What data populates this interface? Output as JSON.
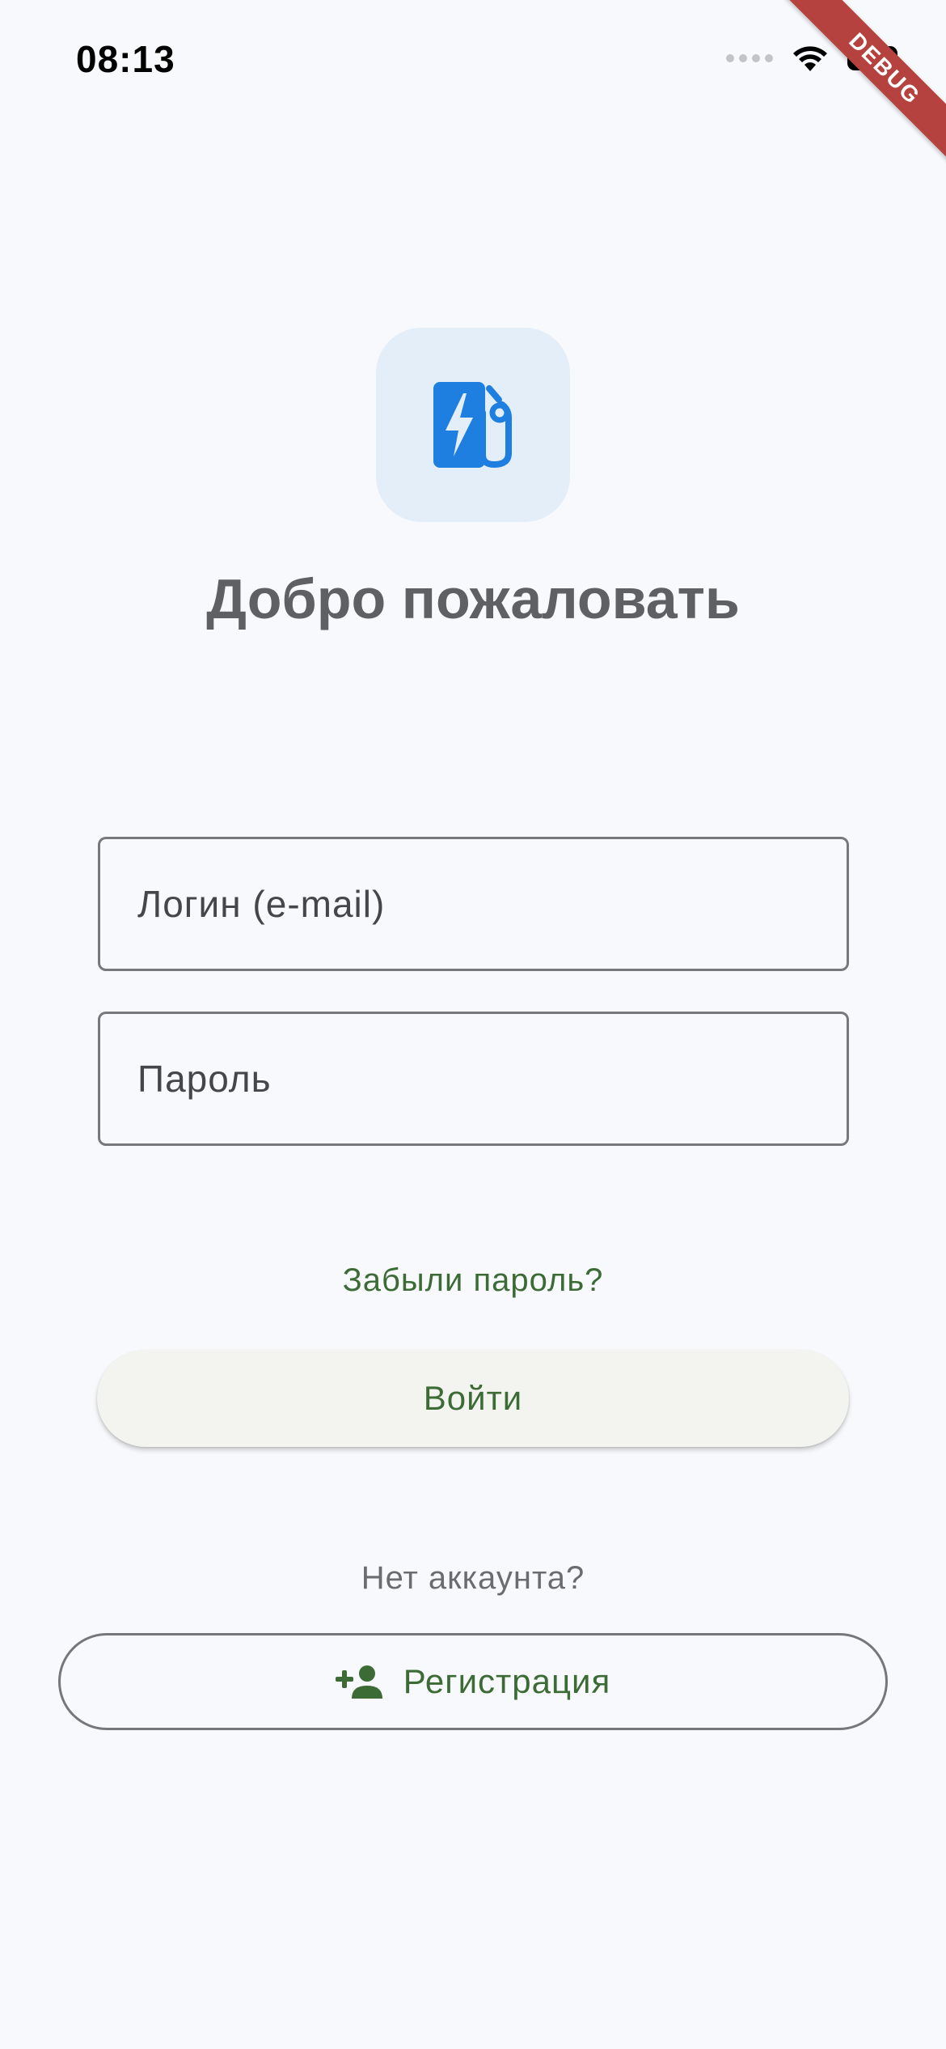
{
  "status_bar": {
    "time": "08:13",
    "icons": [
      "signal-dots-icon",
      "wifi-icon",
      "battery-icon"
    ]
  },
  "debug_banner": {
    "label": "DEBUG",
    "color": "#b5423f"
  },
  "logo": {
    "icon": "ev-charging-station-icon",
    "icon_color": "#1e7fe0",
    "tile_color": "#e4eef9"
  },
  "title": "Добро пожаловать",
  "login_field": {
    "placeholder": "Логин (e-mail)",
    "value": ""
  },
  "password_field": {
    "placeholder": "Пароль",
    "value": ""
  },
  "forgot_password": "Забыли пароль?",
  "login_button": "Войти",
  "no_account": "Нет аккаунта?",
  "register_button": {
    "label": "Регистрация",
    "icon": "person-add-icon"
  },
  "colors": {
    "accent": "#3c6b35",
    "background": "#f8f9fc",
    "title": "#5f6063"
  }
}
